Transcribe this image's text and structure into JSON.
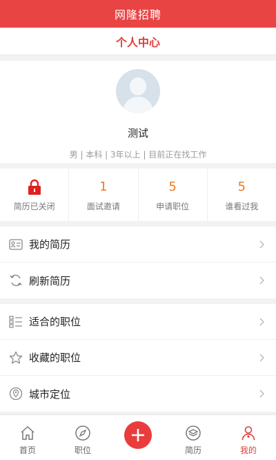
{
  "app": {
    "title": "网隆招聘"
  },
  "header": {
    "title": "个人中心"
  },
  "profile": {
    "name": "测试",
    "meta": "男 | 本科 | 3年以上 | 目前正在找工作"
  },
  "stats": [
    {
      "label": "简历已关闭"
    },
    {
      "value": "1",
      "label": "面试邀请"
    },
    {
      "value": "5",
      "label": "申请职位"
    },
    {
      "value": "5",
      "label": "谁看过我"
    }
  ],
  "menu": {
    "group1": [
      {
        "label": "我的简历",
        "icon": "resume-icon"
      },
      {
        "label": "刷新简历",
        "icon": "refresh-icon"
      }
    ],
    "group2": [
      {
        "label": "适合的职位",
        "icon": "list-icon"
      },
      {
        "label": "收藏的职位",
        "icon": "star-icon"
      },
      {
        "label": "城市定位",
        "icon": "location-icon"
      }
    ]
  },
  "tabs": [
    {
      "label": "首页",
      "icon": "home-icon"
    },
    {
      "label": "职位",
      "icon": "compass-icon"
    },
    {
      "label": "",
      "icon": "plus-icon"
    },
    {
      "label": "简历",
      "icon": "layers-icon"
    },
    {
      "label": "我的",
      "icon": "user-icon",
      "active": true
    }
  ],
  "colors": {
    "brand": "#e84444",
    "accent": "#f07a22",
    "active_tab": "#e23b3b"
  }
}
